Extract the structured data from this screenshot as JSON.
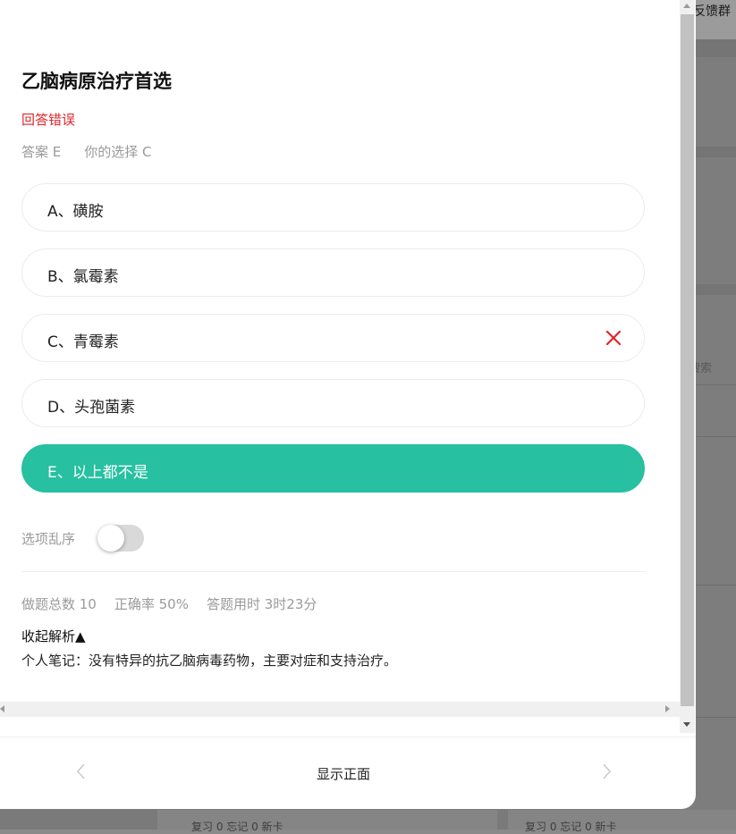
{
  "background": {
    "feedback_label": "反馈群",
    "search_label": "搜索",
    "bottom_left": "复习 0    忘记 0    新卡",
    "bottom_right": "复习 0    忘记 0    新卡"
  },
  "question": {
    "title": "乙脑病原治疗首选",
    "status": "回答错误",
    "answer_label": "答案 E",
    "your_choice_label": "你的选择 C"
  },
  "options": [
    {
      "label": "A、磺胺",
      "state": "normal"
    },
    {
      "label": "B、氯霉素",
      "state": "normal"
    },
    {
      "label": "C、青霉素",
      "state": "wrong"
    },
    {
      "label": "D、头孢菌素",
      "state": "normal"
    },
    {
      "label": "E、以上都不是",
      "state": "correct"
    }
  ],
  "shuffle": {
    "label": "选项乱序",
    "enabled": false
  },
  "stats": {
    "total": "做题总数 10",
    "accuracy": "正确率 50%",
    "time": "答题用时 3时23分"
  },
  "analysis": {
    "toggle_label": "收起解析▲",
    "note": "个人笔记：没有特异的抗乙脑病毒药物，主要对症和支持治疗。"
  },
  "footer": {
    "show_front_label": "显示正面"
  },
  "colors": {
    "correct": "#27c0a1",
    "wrong": "#e0262a",
    "muted": "#9a9a9a"
  }
}
